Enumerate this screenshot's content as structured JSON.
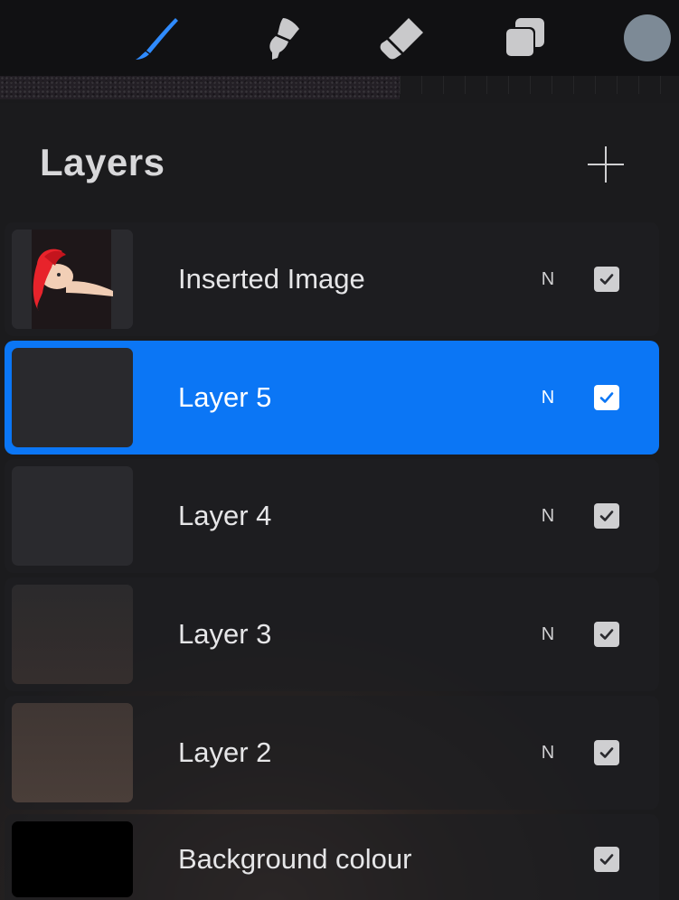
{
  "toolbar": {
    "tools": [
      {
        "name": "brush-icon",
        "active": true
      },
      {
        "name": "smudge-icon",
        "active": false
      },
      {
        "name": "eraser-icon",
        "active": false
      },
      {
        "name": "layers-icon",
        "active": false
      }
    ],
    "current_color": "#7d8a96"
  },
  "colors": {
    "accent": "#0b76f5",
    "row_background": "#1e1e21",
    "text": "#e6e6e8"
  },
  "layers_panel": {
    "title": "Layers",
    "add_icon": "plus-icon",
    "layers": [
      {
        "name": "Inserted Image",
        "blend_mode": "N",
        "visible": true,
        "selected": false
      },
      {
        "name": "Layer 5",
        "blend_mode": "N",
        "visible": true,
        "selected": true
      },
      {
        "name": "Layer 4",
        "blend_mode": "N",
        "visible": true,
        "selected": false
      },
      {
        "name": "Layer 3",
        "blend_mode": "N",
        "visible": true,
        "selected": false
      },
      {
        "name": "Layer 2",
        "blend_mode": "N",
        "visible": true,
        "selected": false
      },
      {
        "name": "Background colour",
        "visible": true,
        "selected": false,
        "fill_color": "#000000"
      }
    ]
  }
}
